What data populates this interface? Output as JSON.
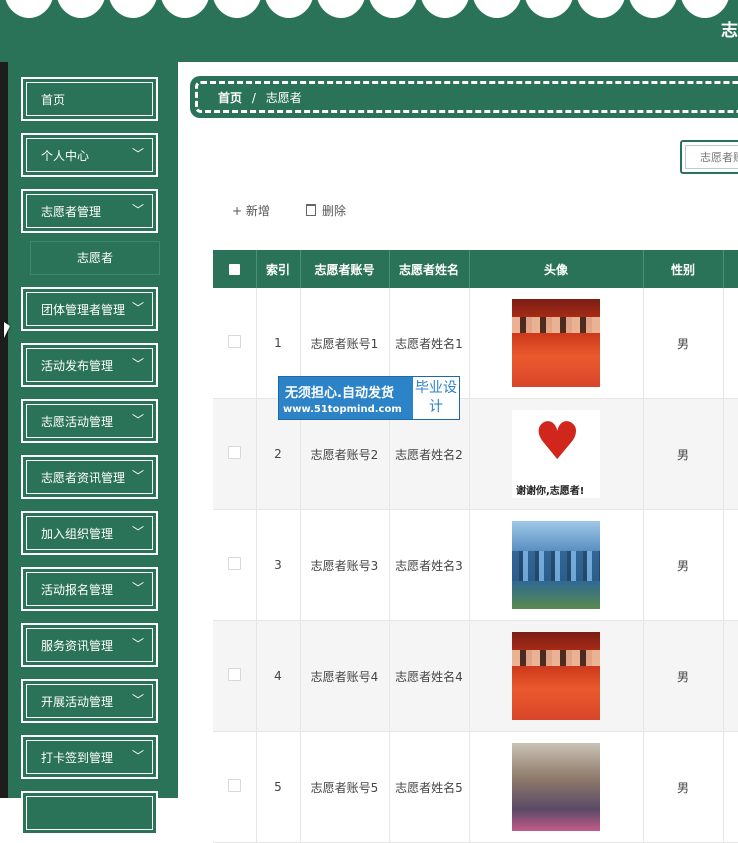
{
  "header": {
    "title": "志"
  },
  "sidebar": {
    "items": [
      {
        "label": "首页",
        "has_arrow": false
      },
      {
        "label": "个人中心",
        "has_arrow": true
      },
      {
        "label": "志愿者管理",
        "has_arrow": true
      },
      {
        "label": "团体管理者管理",
        "has_arrow": true
      },
      {
        "label": "活动发布管理",
        "has_arrow": true
      },
      {
        "label": "志愿活动管理",
        "has_arrow": true
      },
      {
        "label": "志愿者资讯管理",
        "has_arrow": true
      },
      {
        "label": "加入组织管理",
        "has_arrow": true
      },
      {
        "label": "活动报名管理",
        "has_arrow": true
      },
      {
        "label": "服务资讯管理",
        "has_arrow": true
      },
      {
        "label": "开展活动管理",
        "has_arrow": true
      },
      {
        "label": "打卡签到管理",
        "has_arrow": true
      }
    ],
    "submenu": {
      "label": "志愿者"
    }
  },
  "breadcrumb": {
    "home": "首页",
    "separator": "/",
    "current": "志愿者"
  },
  "search": {
    "placeholder": "志愿者账"
  },
  "actions": {
    "add": "+ 新增",
    "delete_icon": "trash-icon",
    "delete": "删除"
  },
  "table": {
    "columns": [
      "索引",
      "志愿者账号",
      "志愿者姓名",
      "头像",
      "性别"
    ],
    "rows": [
      {
        "index": "1",
        "account": "志愿者账号1",
        "name": "志愿者姓名1",
        "avatar": "crowd-red",
        "gender": "男"
      },
      {
        "index": "2",
        "account": "志愿者账号2",
        "name": "志愿者姓名2",
        "avatar": "heart-logo",
        "gender": "男"
      },
      {
        "index": "3",
        "account": "志愿者账号3",
        "name": "志愿者姓名3",
        "avatar": "crowd-blue",
        "gender": "男"
      },
      {
        "index": "4",
        "account": "志愿者账号4",
        "name": "志愿者姓名4",
        "avatar": "crowd-red",
        "gender": "男"
      },
      {
        "index": "5",
        "account": "志愿者账号5",
        "name": "志愿者姓名5",
        "avatar": "people-photo",
        "gender": "男"
      }
    ],
    "heart_avatar_caption": "谢谢你,志愿者!"
  },
  "watermark": {
    "line1": "无须担心.自动发货",
    "line2": "www.51topmind.com",
    "badge": "毕业设计"
  },
  "colors": {
    "primary": "#2b7358",
    "watermark": "#2c83c8"
  }
}
